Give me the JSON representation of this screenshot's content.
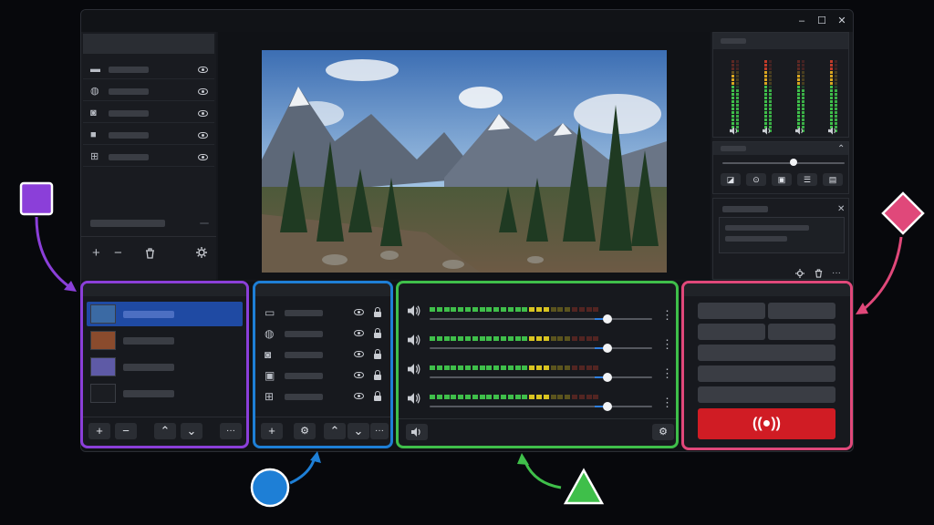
{
  "window": {
    "controls": {
      "minimize": "–",
      "maximize": "☐",
      "close": "✕"
    }
  },
  "left_column": {
    "items": [
      {
        "icon": "chat-icon"
      },
      {
        "icon": "globe-icon"
      },
      {
        "icon": "camera-icon"
      },
      {
        "icon": "video-icon"
      },
      {
        "icon": "plus-box-icon"
      }
    ],
    "toolbar": {
      "add": "+",
      "remove": "−",
      "delete_icon": "trash-icon",
      "settings_icon": "gear-icon"
    }
  },
  "preview": {
    "image": "mountain-lake-landscape"
  },
  "right_column": {
    "mixer_channels": 4,
    "buttons": [
      "record-icon",
      "camera-icon",
      "image-icon",
      "list-icon",
      "scene-icon"
    ],
    "close_label": "✕",
    "footer_icons": [
      "gear-icon",
      "trash-icon",
      "more-icon"
    ],
    "footer_more": "···"
  },
  "scenes_panel": {
    "accent": "#8b3fd9",
    "toolbar": {
      "add": "+",
      "remove": "−",
      "up": "⌃",
      "down": "⌄",
      "more": "···"
    }
  },
  "sources_panel": {
    "accent": "#1e7fd6",
    "items": [
      {
        "icon": "monitor-icon"
      },
      {
        "icon": "globe-icon"
      },
      {
        "icon": "camera-icon"
      },
      {
        "icon": "image-icon"
      },
      {
        "icon": "plus-box-icon"
      }
    ],
    "toolbar": {
      "add": "+",
      "settings": "⚙",
      "up": "⌃",
      "down": "⌄",
      "more": "···"
    }
  },
  "audio_panel": {
    "accent": "#3fbf4a",
    "channels": [
      {
        "level": 0.72,
        "volume": 0.8
      },
      {
        "level": 0.72,
        "volume": 0.8
      },
      {
        "level": 0.72,
        "volume": 0.8
      },
      {
        "level": 0.72,
        "volume": 0.8
      }
    ],
    "menu": "⋮",
    "footer_gear": "⚙"
  },
  "controls_panel": {
    "accent": "#e0487a",
    "live_label": "((●))",
    "live_color": "#d01c24"
  },
  "legend": {
    "square_color": "#8b3fd9",
    "circle_color": "#1e7fd6",
    "triangle_color": "#3fbf4a",
    "diamond_color": "#e0487a"
  }
}
